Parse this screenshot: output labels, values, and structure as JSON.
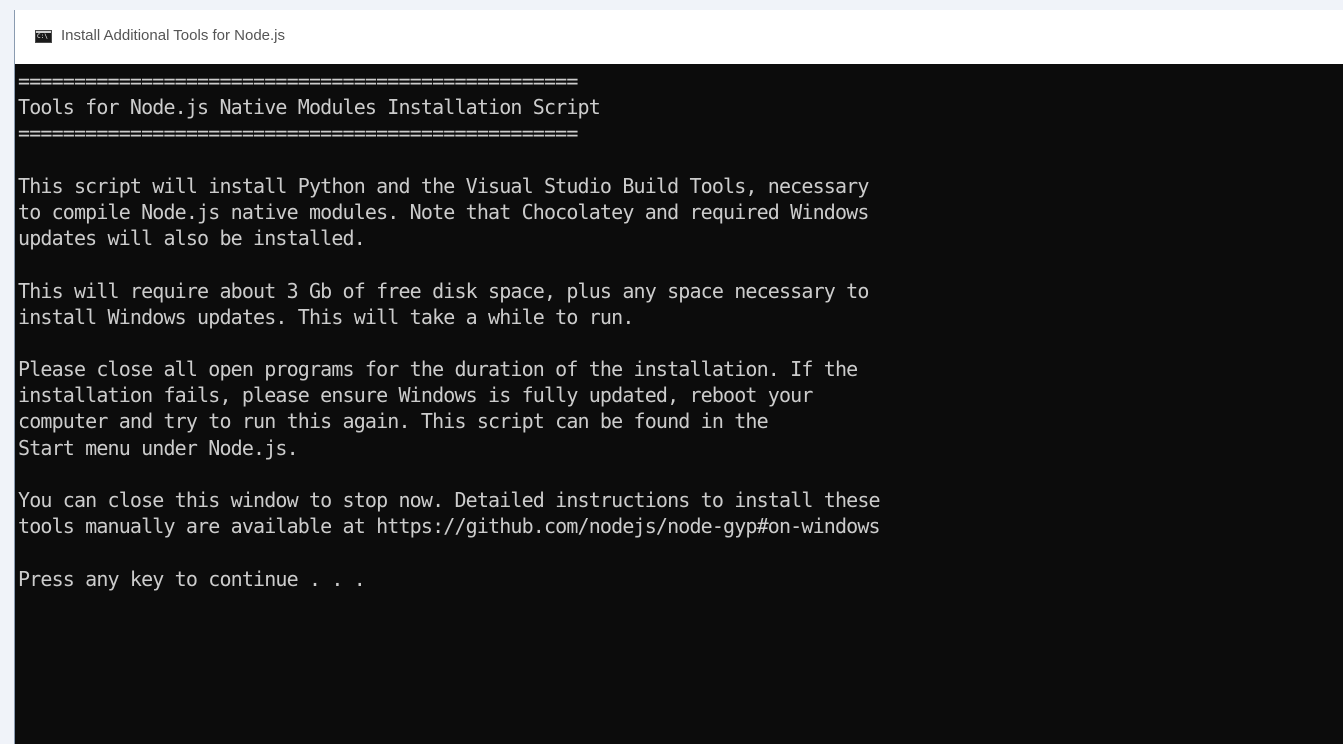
{
  "window": {
    "title": "Install Additional Tools for Node.js",
    "icon_text": "C:\\"
  },
  "console": {
    "lines": [
      "==================================================",
      "Tools for Node.js Native Modules Installation Script",
      "==================================================",
      "",
      "This script will install Python and the Visual Studio Build Tools, necessary",
      "to compile Node.js native modules. Note that Chocolatey and required Windows",
      "updates will also be installed.",
      "",
      "This will require about 3 Gb of free disk space, plus any space necessary to",
      "install Windows updates. This will take a while to run.",
      "",
      "Please close all open programs for the duration of the installation. If the",
      "installation fails, please ensure Windows is fully updated, reboot your",
      "computer and try to run this again. This script can be found in the",
      "Start menu under Node.js.",
      "",
      "You can close this window to stop now. Detailed instructions to install these",
      "tools manually are available at https://github.com/nodejs/node-gyp#on-windows",
      "",
      "Press any key to continue . . ."
    ]
  },
  "colors": {
    "console_bg": "#0c0c0c",
    "console_fg": "#cccccc",
    "titlebar_bg": "#ffffff",
    "titlebar_fg": "#555555"
  }
}
